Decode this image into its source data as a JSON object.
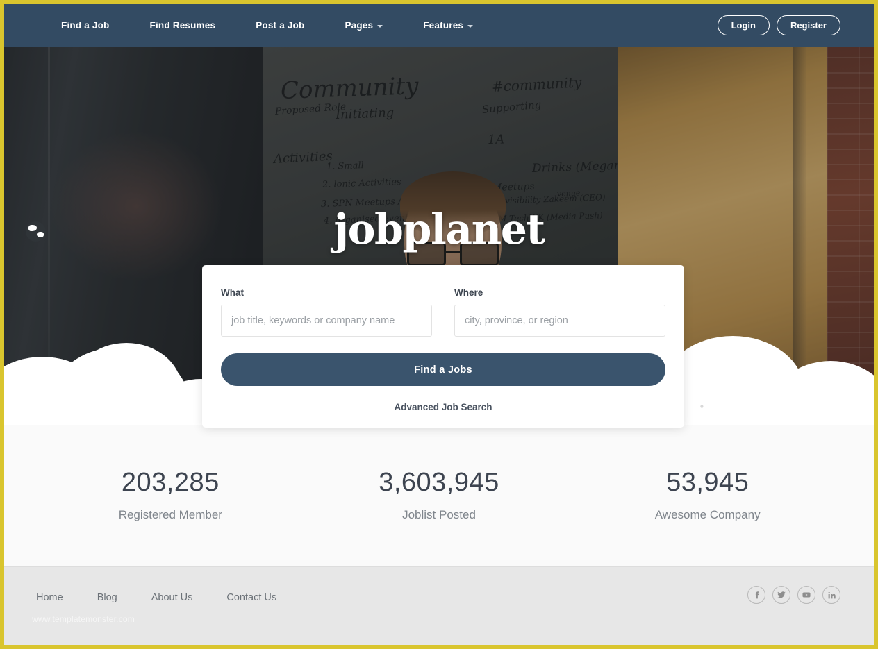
{
  "nav": {
    "items": [
      {
        "label": "Find a Job",
        "has_caret": false,
        "name": "nav-find-a-job"
      },
      {
        "label": "Find Resumes",
        "has_caret": false,
        "name": "nav-find-resumes"
      },
      {
        "label": "Post a Job",
        "has_caret": false,
        "name": "nav-post-a-job"
      },
      {
        "label": "Pages",
        "has_caret": true,
        "name": "nav-pages"
      },
      {
        "label": "Features",
        "has_caret": true,
        "name": "nav-features"
      }
    ],
    "login_label": "Login",
    "register_label": "Register",
    "background_color": "#334b63"
  },
  "hero": {
    "logo_text": "jobplanet",
    "logo_icon": "globe-icon",
    "whiteboard_notes": [
      "Community",
      "#community",
      "Proposed Role",
      "Initiating",
      "Supporting",
      "Activities",
      "1A",
      "1. Small",
      "2. lonic Activities",
      "3. SPN Meetups / Expat",
      "4. organised events",
      "Drinks (Megan)",
      "Meetups",
      "/ml visibility Zakeem (CEO)",
      "BSM TechWK (Media Push)",
      "venue"
    ],
    "carousel_dot": "carousel-indicator",
    "rocket_icon": "rocket-icon"
  },
  "search": {
    "what_label": "What",
    "what_value": "",
    "what_placeholder": "job title, keywords or company name",
    "where_label": "Where",
    "where_value": "",
    "where_placeholder": "city, province, or region",
    "submit_label": "Find a Jobs",
    "advanced_label": "Advanced Job Search",
    "button_color": "#3a546d"
  },
  "stats": [
    {
      "value": "203,285",
      "label": "Registered Member",
      "name": "stat-registered-member"
    },
    {
      "value": "3,603,945",
      "label": "Joblist Posted",
      "name": "stat-joblist-posted"
    },
    {
      "value": "53,945",
      "label": "Awesome Company",
      "name": "stat-awesome-company"
    }
  ],
  "footer": {
    "links": [
      {
        "label": "Home",
        "name": "footer-link-home"
      },
      {
        "label": "Blog",
        "name": "footer-link-blog"
      },
      {
        "label": "About Us",
        "name": "footer-link-about-us"
      },
      {
        "label": "Contact Us",
        "name": "footer-link-contact-us"
      }
    ],
    "social": [
      {
        "icon": "facebook-icon",
        "name": "social-link-facebook"
      },
      {
        "icon": "twitter-icon",
        "name": "social-link-twitter"
      },
      {
        "icon": "youtube-icon",
        "name": "social-link-youtube"
      },
      {
        "icon": "linkedin-icon",
        "name": "social-link-linkedin"
      }
    ],
    "watermark": "www.templatemonster.com"
  },
  "theme": {
    "page_border_color": "#d9c52e",
    "nav_color": "#334b63",
    "accent_color": "#3a546d",
    "stats_background": "#fafafa",
    "footer_background": "#e7e7e7"
  }
}
